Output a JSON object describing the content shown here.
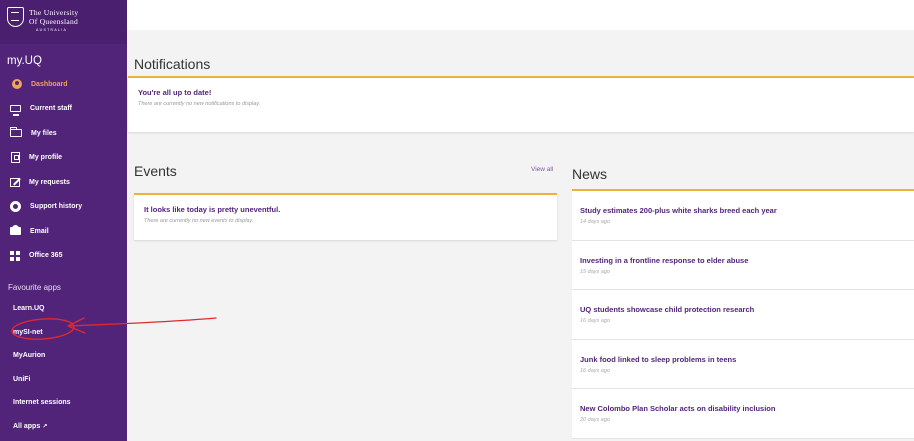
{
  "brand": {
    "line1": "The University",
    "line2": "Of Queensland",
    "line3": "AUSTRALIA"
  },
  "sidebar": {
    "app_title": "my.UQ",
    "nav": [
      {
        "label": "Dashboard",
        "icon": "dashboard-icon",
        "active": true
      },
      {
        "label": "Current staff",
        "icon": "monitor-icon"
      },
      {
        "label": "My files",
        "icon": "folder-icon"
      },
      {
        "label": "My profile",
        "icon": "id-card-icon"
      },
      {
        "label": "My requests",
        "icon": "edit-icon"
      },
      {
        "label": "Support history",
        "icon": "lifebuoy-icon"
      },
      {
        "label": "Email",
        "icon": "mail-icon"
      },
      {
        "label": "Office 365",
        "icon": "grid-icon"
      }
    ],
    "favourites_title": "Favourite apps",
    "favourites": [
      {
        "label": "Learn.UQ"
      },
      {
        "label": "mySI-net"
      },
      {
        "label": "MyAurion"
      },
      {
        "label": "UniFi"
      },
      {
        "label": "Internet sessions"
      },
      {
        "label": "All apps",
        "suffix": "↗"
      }
    ]
  },
  "notifications": {
    "heading": "Notifications",
    "title": "You're all up to date!",
    "subtitle": "There are currently no new notifications to display."
  },
  "events": {
    "heading": "Events",
    "view_all": "View all",
    "title": "It looks like today is pretty uneventful.",
    "subtitle": "There are currently no new events to display."
  },
  "news": {
    "heading": "News",
    "items": [
      {
        "title": "Study estimates 200-plus white sharks breed each year",
        "age": "14 days ago"
      },
      {
        "title": "Investing in a frontline response to elder abuse",
        "age": "15 days ago"
      },
      {
        "title": "UQ students showcase child protection research",
        "age": "16 days ago"
      },
      {
        "title": "Junk food linked to sleep problems in teens",
        "age": "16 days ago"
      },
      {
        "title": "New Colombo Plan Scholar acts on disability inclusion",
        "age": "20 days ago"
      }
    ]
  },
  "colors": {
    "sidebar_bg": "#51247a",
    "accent_orange": "#f0a35a",
    "card_border": "#f0b040",
    "annotation_red": "#e0282e"
  }
}
